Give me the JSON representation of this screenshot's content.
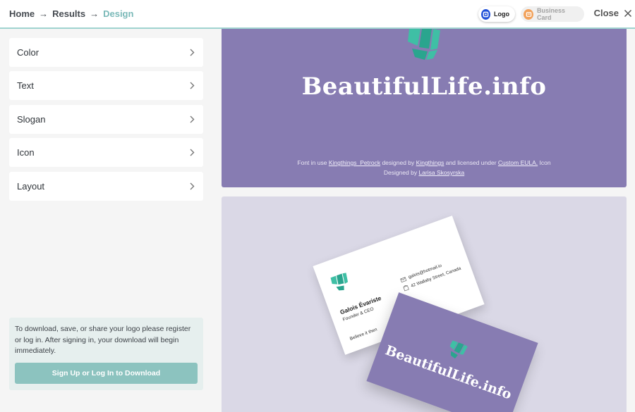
{
  "breadcrumb": {
    "home": "Home",
    "results": "Results",
    "current": "Design",
    "separator": "→"
  },
  "header": {
    "tabs": [
      {
        "label": "Logo",
        "icon": "logo-icon",
        "active": true
      },
      {
        "label": "Business Card",
        "icon": "business-card-icon",
        "active": false
      }
    ],
    "close_label": "Close"
  },
  "sidebar": {
    "items": [
      {
        "label": "Color"
      },
      {
        "label": "Text"
      },
      {
        "label": "Slogan"
      },
      {
        "label": "Icon"
      },
      {
        "label": "Layout"
      }
    ],
    "notice": {
      "text": "To download, save, or share your logo please register or log in. After signing in, your download will begin immediately.",
      "button_label": "Sign Up or Log In to Download"
    }
  },
  "preview": {
    "brand_name": "BeautifulLife.info",
    "credits": {
      "t1": "Font in use ",
      "font_link": "Kingthings_Petrock",
      "t2": " designed by ",
      "designer_link": "Kingthings",
      "t3": " and licensed under ",
      "license_link": "Custom EULA.",
      "t4": " Icon",
      "t5": "Designed by ",
      "icon_designer_link": "Larisa Skosyrska"
    },
    "business_card": {
      "name": "Galois Évariste",
      "role": "Founder & CEO",
      "tagline": "Believe it then",
      "email": "galois@hotmail.io",
      "address": "42 Wallaby Street, Canada",
      "brand_name": "BeautifulLife.info"
    }
  },
  "colors": {
    "accent": "#8cc3bf",
    "brand_purple": "#877cb2",
    "logo_green": "#3fbfa5"
  }
}
